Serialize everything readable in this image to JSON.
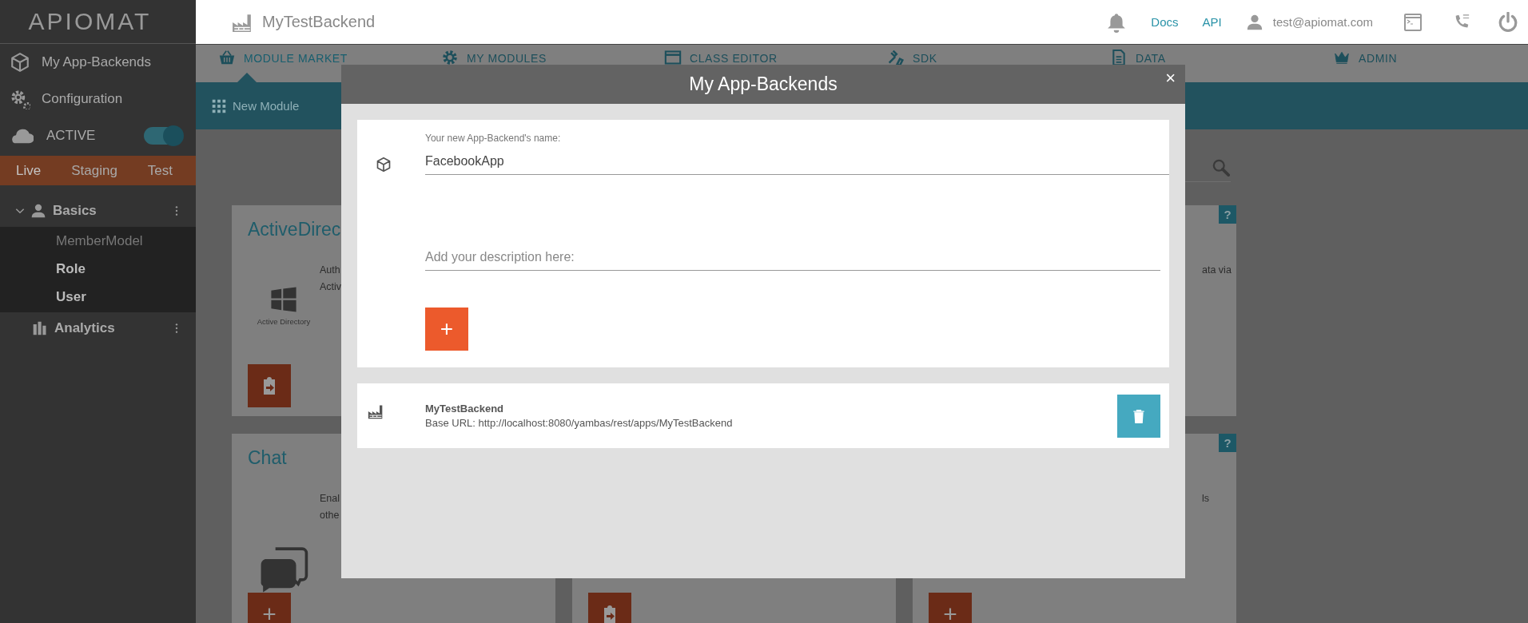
{
  "sidebar": {
    "logo": "APIOMAT",
    "items": [
      {
        "label": "My App-Backends"
      },
      {
        "label": "Configuration"
      }
    ],
    "status": {
      "label": "ACTIVE",
      "on": true
    },
    "environments": [
      {
        "label": "Live",
        "selected": true
      },
      {
        "label": "Staging",
        "selected": false
      },
      {
        "label": "Test",
        "selected": false
      }
    ],
    "groups": [
      {
        "label": "Basics",
        "expanded": true,
        "children": [
          {
            "label": "MemberModel",
            "disabled": true
          },
          {
            "label": "Role",
            "disabled": false
          },
          {
            "label": "User",
            "disabled": false
          }
        ]
      },
      {
        "label": "Analytics"
      }
    ]
  },
  "header": {
    "backend": "MyTestBackend",
    "links": [
      "Docs",
      "API"
    ],
    "user": "test@apiomat.com"
  },
  "nav": {
    "tabs": [
      {
        "label": "MODULE MARKET",
        "selected": true
      },
      {
        "label": "MY MODULES",
        "selected": false
      },
      {
        "label": "CLASS EDITOR",
        "selected": false
      },
      {
        "label": "SDK",
        "selected": false
      },
      {
        "label": "DATA",
        "selected": false
      },
      {
        "label": "ADMIN",
        "selected": false
      }
    ]
  },
  "toolbar": {
    "new_module": "New Module"
  },
  "cards": [
    {
      "title": "ActiveDirec",
      "logo_caption": "Active Directory",
      "description": [
        "Auth",
        "Activ"
      ],
      "button": {
        "kind": "import"
      }
    },
    {
      "help": "?",
      "description": [
        "ata via"
      ]
    },
    {
      "title": "Chat",
      "description": [
        "Enal",
        "othe"
      ],
      "button": {
        "kind": "add",
        "label": "+"
      }
    },
    {
      "button": {
        "kind": "import"
      }
    },
    {
      "help": "?",
      "description": [
        "ls"
      ],
      "button": {
        "kind": "add",
        "label": "+"
      }
    }
  ],
  "modal": {
    "title": "My App-Backends",
    "close": "×",
    "form": {
      "name_label": "Your new App-Backend's name:",
      "name_value": "FacebookApp",
      "description_placeholder": "Add your description here:",
      "add_button": "+"
    },
    "backends": [
      {
        "name": "MyTestBackend",
        "base_url": "Base URL: http://localhost:8080/yambas/rest/apps/MyTestBackend"
      }
    ]
  }
}
